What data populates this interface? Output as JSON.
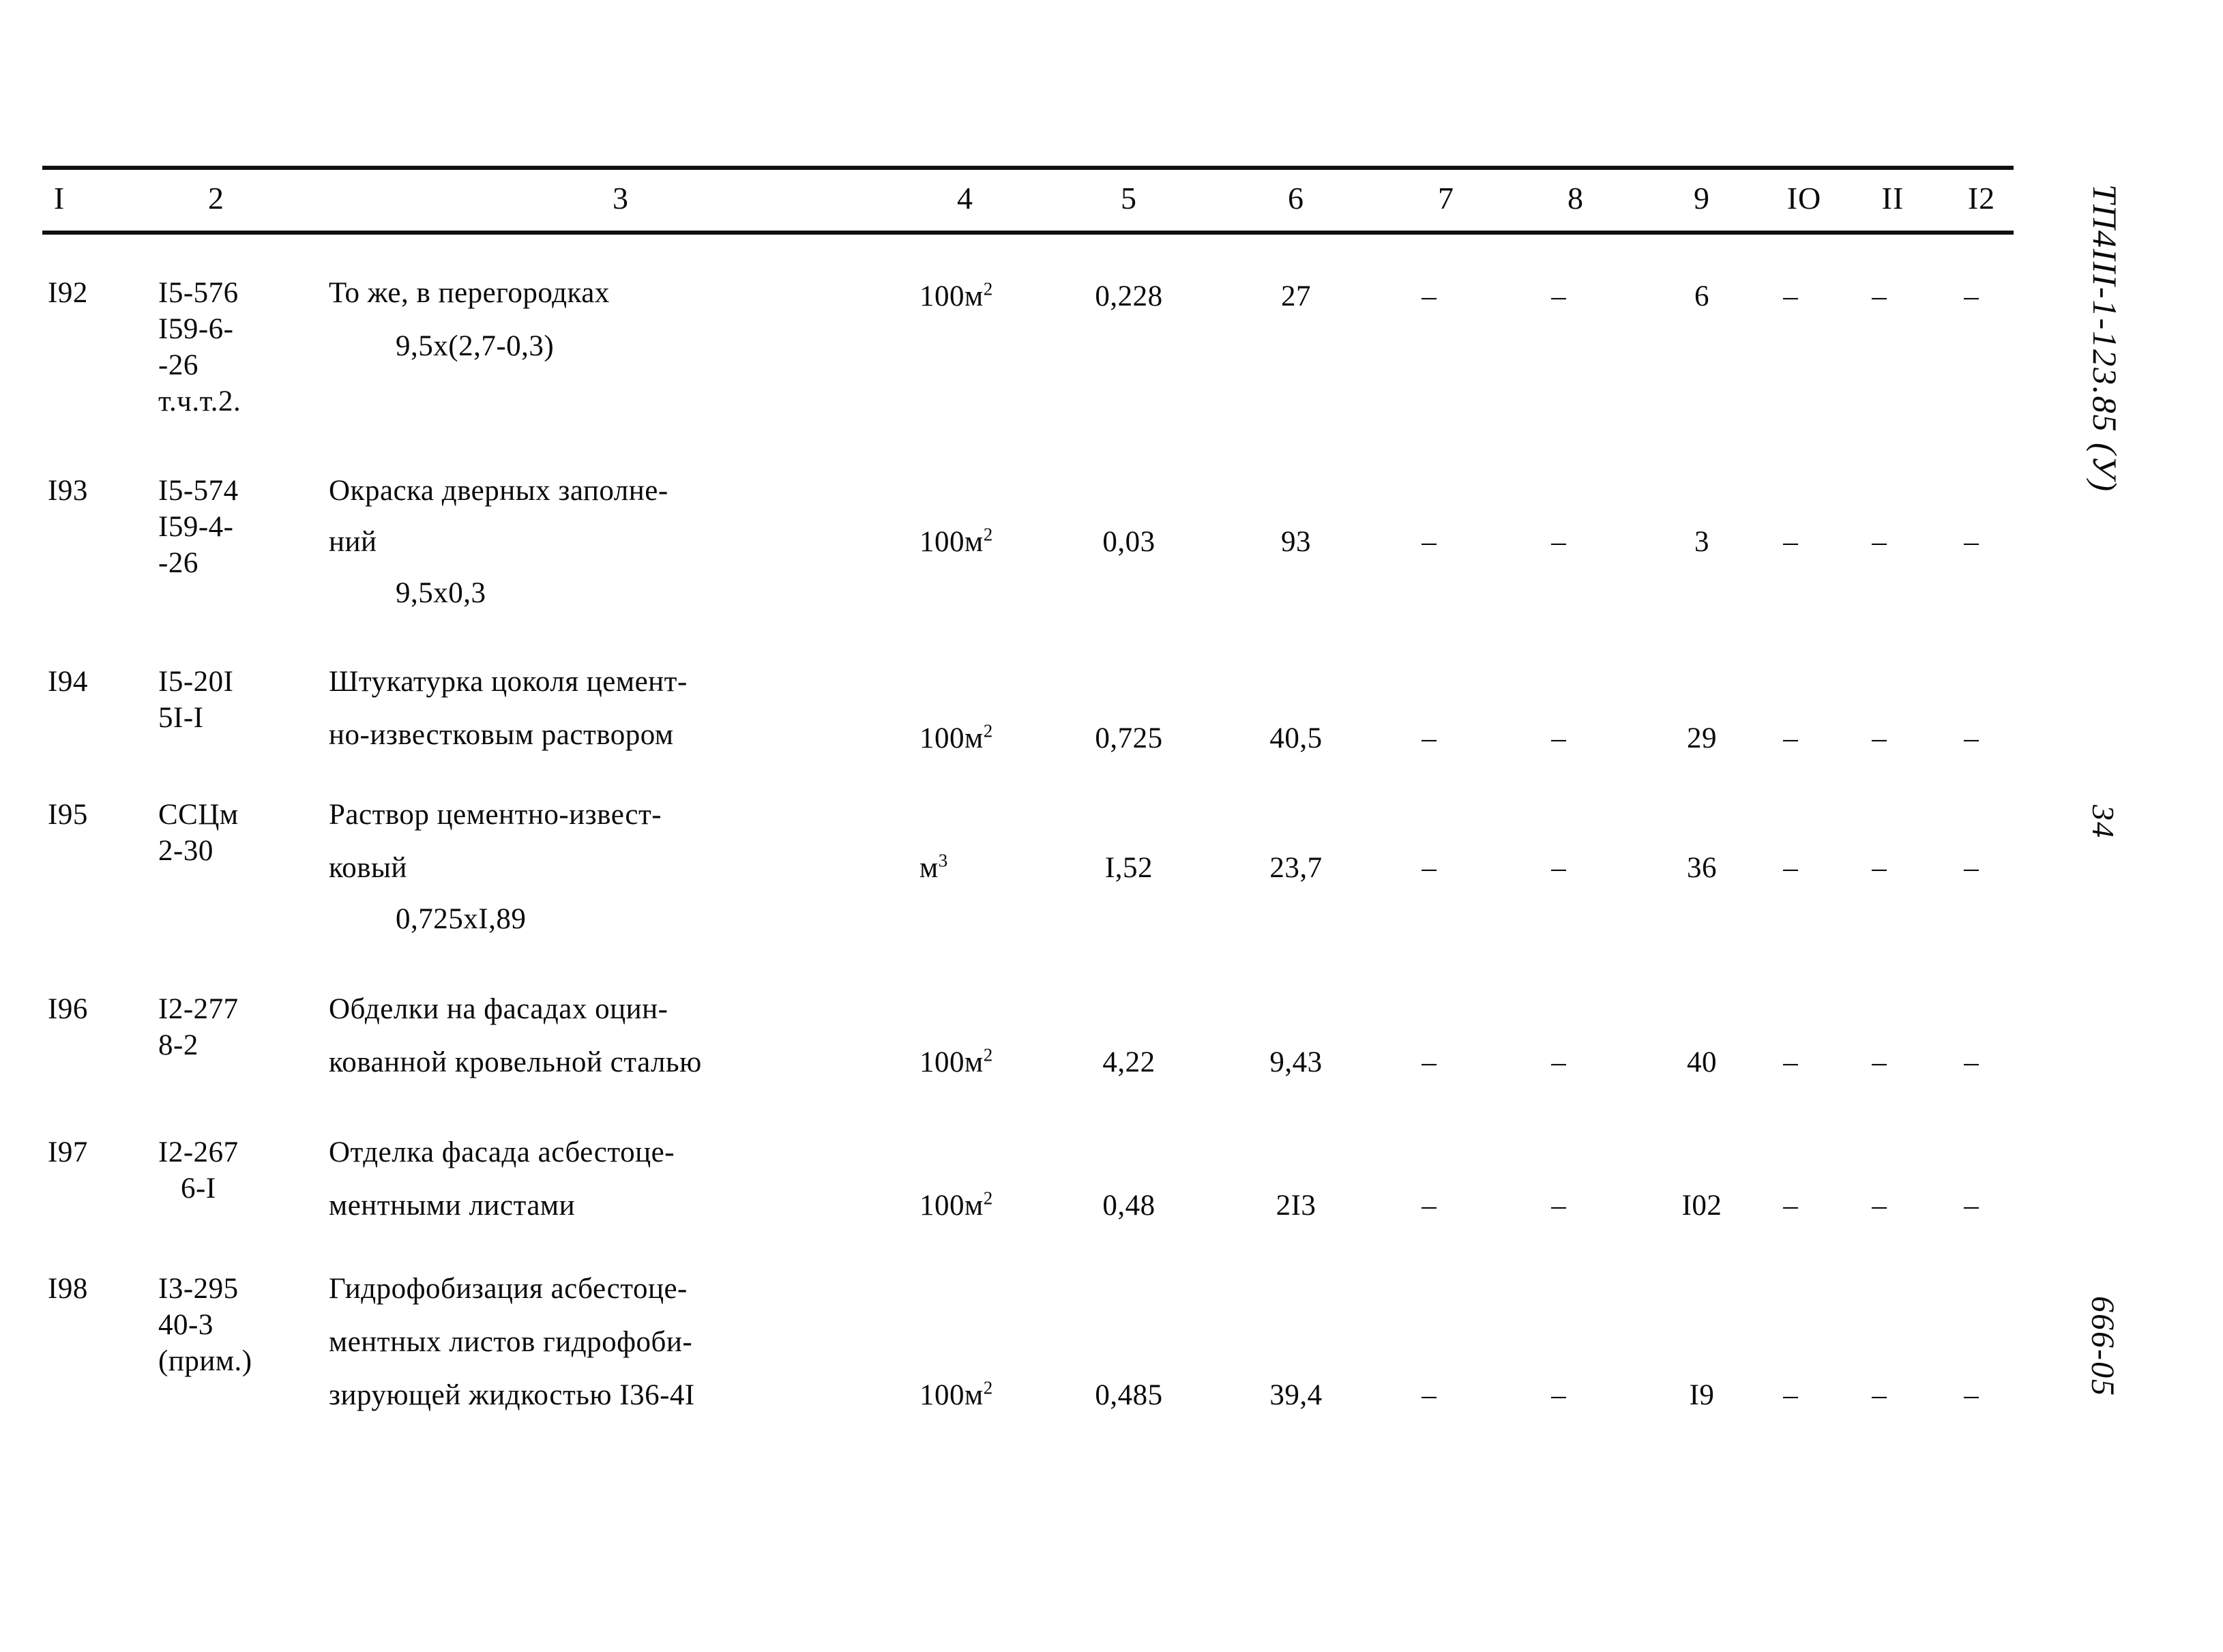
{
  "document": {
    "sheet_code": "ТП4III-1-123.85 (У)",
    "page_number": "34",
    "doc_number": "666-05"
  },
  "table": {
    "column_headers": [
      "I",
      "2",
      "3",
      "4",
      "5",
      "6",
      "7",
      "8",
      "9",
      "IO",
      "II",
      "I2"
    ],
    "dash": "–",
    "rows": [
      {
        "num": "I92",
        "code_lines": [
          "I5-576",
          "I59-6-",
          "-26",
          "т.ч.т.2."
        ],
        "desc_lines": [
          "То же, в перегородках",
          "9,5х(2,7-0,3)"
        ],
        "unit": "100м",
        "unit_sup": "2",
        "col5": "0,228",
        "col6": "27",
        "col7": "–",
        "col8": "–",
        "col9": "6",
        "col10": "–",
        "col11": "–",
        "col12": "–"
      },
      {
        "num": "I93",
        "code_lines": [
          "I5-574",
          "I59-4-",
          "-26"
        ],
        "desc_lines": [
          "Окраска дверных заполне-",
          "ний",
          "9,5х0,3"
        ],
        "unit": "100м",
        "unit_sup": "2",
        "col5": "0,03",
        "col6": "93",
        "col7": "–",
        "col8": "–",
        "col9": "3",
        "col10": "–",
        "col11": "–",
        "col12": "–"
      },
      {
        "num": "I94",
        "code_lines": [
          "I5-20I",
          "5I-I"
        ],
        "desc_lines": [
          "Штукатурка цоколя цемент-",
          "но-известковым раствором"
        ],
        "unit": "100м",
        "unit_sup": "2",
        "col5": "0,725",
        "col6": "40,5",
        "col7": "–",
        "col8": "–",
        "col9": "29",
        "col10": "–",
        "col11": "–",
        "col12": "–"
      },
      {
        "num": "I95",
        "code_lines": [
          "ССЦм",
          "2-30"
        ],
        "desc_lines": [
          "Раствор цементно-извест-",
          "ковый",
          "0,725хI,89"
        ],
        "unit": "м",
        "unit_sup": "3",
        "col5": "I,52",
        "col6": "23,7",
        "col7": "–",
        "col8": "–",
        "col9": "36",
        "col10": "–",
        "col11": "–",
        "col12": "–"
      },
      {
        "num": "I96",
        "code_lines": [
          "I2-277",
          "8-2"
        ],
        "desc_lines": [
          "Обделки на фасадах оцин-",
          "кованной кровельной сталью"
        ],
        "unit": "100м",
        "unit_sup": "2",
        "col5": "4,22",
        "col6": "9,43",
        "col7": "–",
        "col8": "–",
        "col9": "40",
        "col10": "–",
        "col11": "–",
        "col12": "–"
      },
      {
        "num": "I97",
        "code_lines": [
          "I2-267",
          "6-I"
        ],
        "desc_lines": [
          "Отделка фасада асбестоце-",
          "ментными листами"
        ],
        "unit": "100м",
        "unit_sup": "2",
        "col5": "0,48",
        "col6": "2I3",
        "col7": "–",
        "col8": "–",
        "col9": "I02",
        "col10": "–",
        "col11": "–",
        "col12": "–"
      },
      {
        "num": "I98",
        "code_lines": [
          "I3-295",
          "40-3",
          "(прим.)"
        ],
        "desc_lines": [
          "Гидрофобизация асбестоце-",
          "ментных листов гидрофоби-",
          "зирующей жидкостью I36-4I"
        ],
        "unit": "100м",
        "unit_sup": "2",
        "col5": "0,485",
        "col6": "39,4",
        "col7": "–",
        "col8": "–",
        "col9": "I9",
        "col10": "–",
        "col11": "–",
        "col12": "–"
      }
    ]
  }
}
